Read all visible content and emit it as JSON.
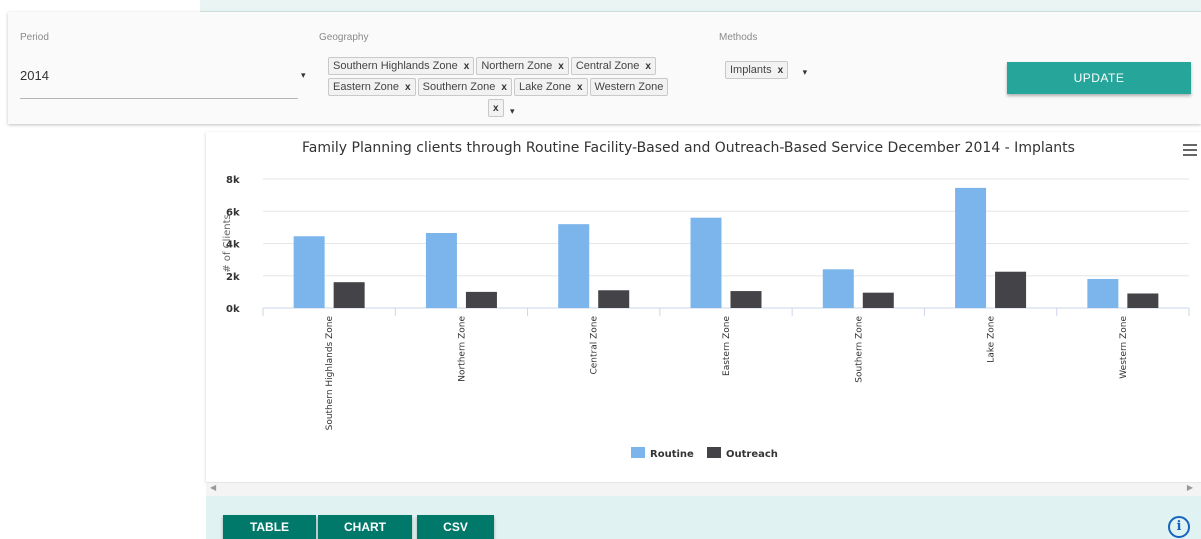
{
  "filters": {
    "period_label": "Period",
    "period_value": "2014",
    "geography_label": "Geography",
    "geography_chips": [
      "Southern Highlands Zone",
      "Northern Zone",
      "Central Zone",
      "Eastern Zone",
      "Southern Zone",
      "Lake Zone",
      "Western Zone"
    ],
    "methods_label": "Methods",
    "methods_chips": [
      "Implants"
    ],
    "remove_symbol": "x",
    "caret_symbol": "▾",
    "update_label": "UPDATE"
  },
  "chart_data": {
    "type": "bar",
    "title": "Family Planning clients through Routine Facility-Based and Outreach-Based Service December 2014 - Implants",
    "ylabel": "# of Clients",
    "xlabel": "",
    "categories": [
      "Southern Highlands Zone",
      "Northern Zone",
      "Central Zone",
      "Eastern Zone",
      "Southern Zone",
      "Lake Zone",
      "Western Zone"
    ],
    "series": [
      {
        "name": "Routine",
        "values": [
          4450,
          4650,
          5200,
          5600,
          2400,
          7450,
          1800
        ],
        "color": "#7cb5ec"
      },
      {
        "name": "Outreach",
        "values": [
          1600,
          1000,
          1100,
          1050,
          950,
          2250,
          900
        ],
        "color": "#434348"
      }
    ],
    "ylim": [
      0,
      8000
    ],
    "yticks": [
      0,
      2000,
      4000,
      6000,
      8000
    ],
    "ytick_labels": [
      "0k",
      "2k",
      "4k",
      "6k",
      "8k"
    ],
    "grid": true,
    "legend_position": "bottom-center"
  },
  "bottom": {
    "table_label": "TABLE",
    "chart_label": "CHART",
    "csv_label": "CSV",
    "info_symbol": "i"
  },
  "colors": {
    "accent": "#26a69a",
    "button": "#00796b",
    "panel": "#e0f2f1",
    "info": "#1565c0"
  }
}
